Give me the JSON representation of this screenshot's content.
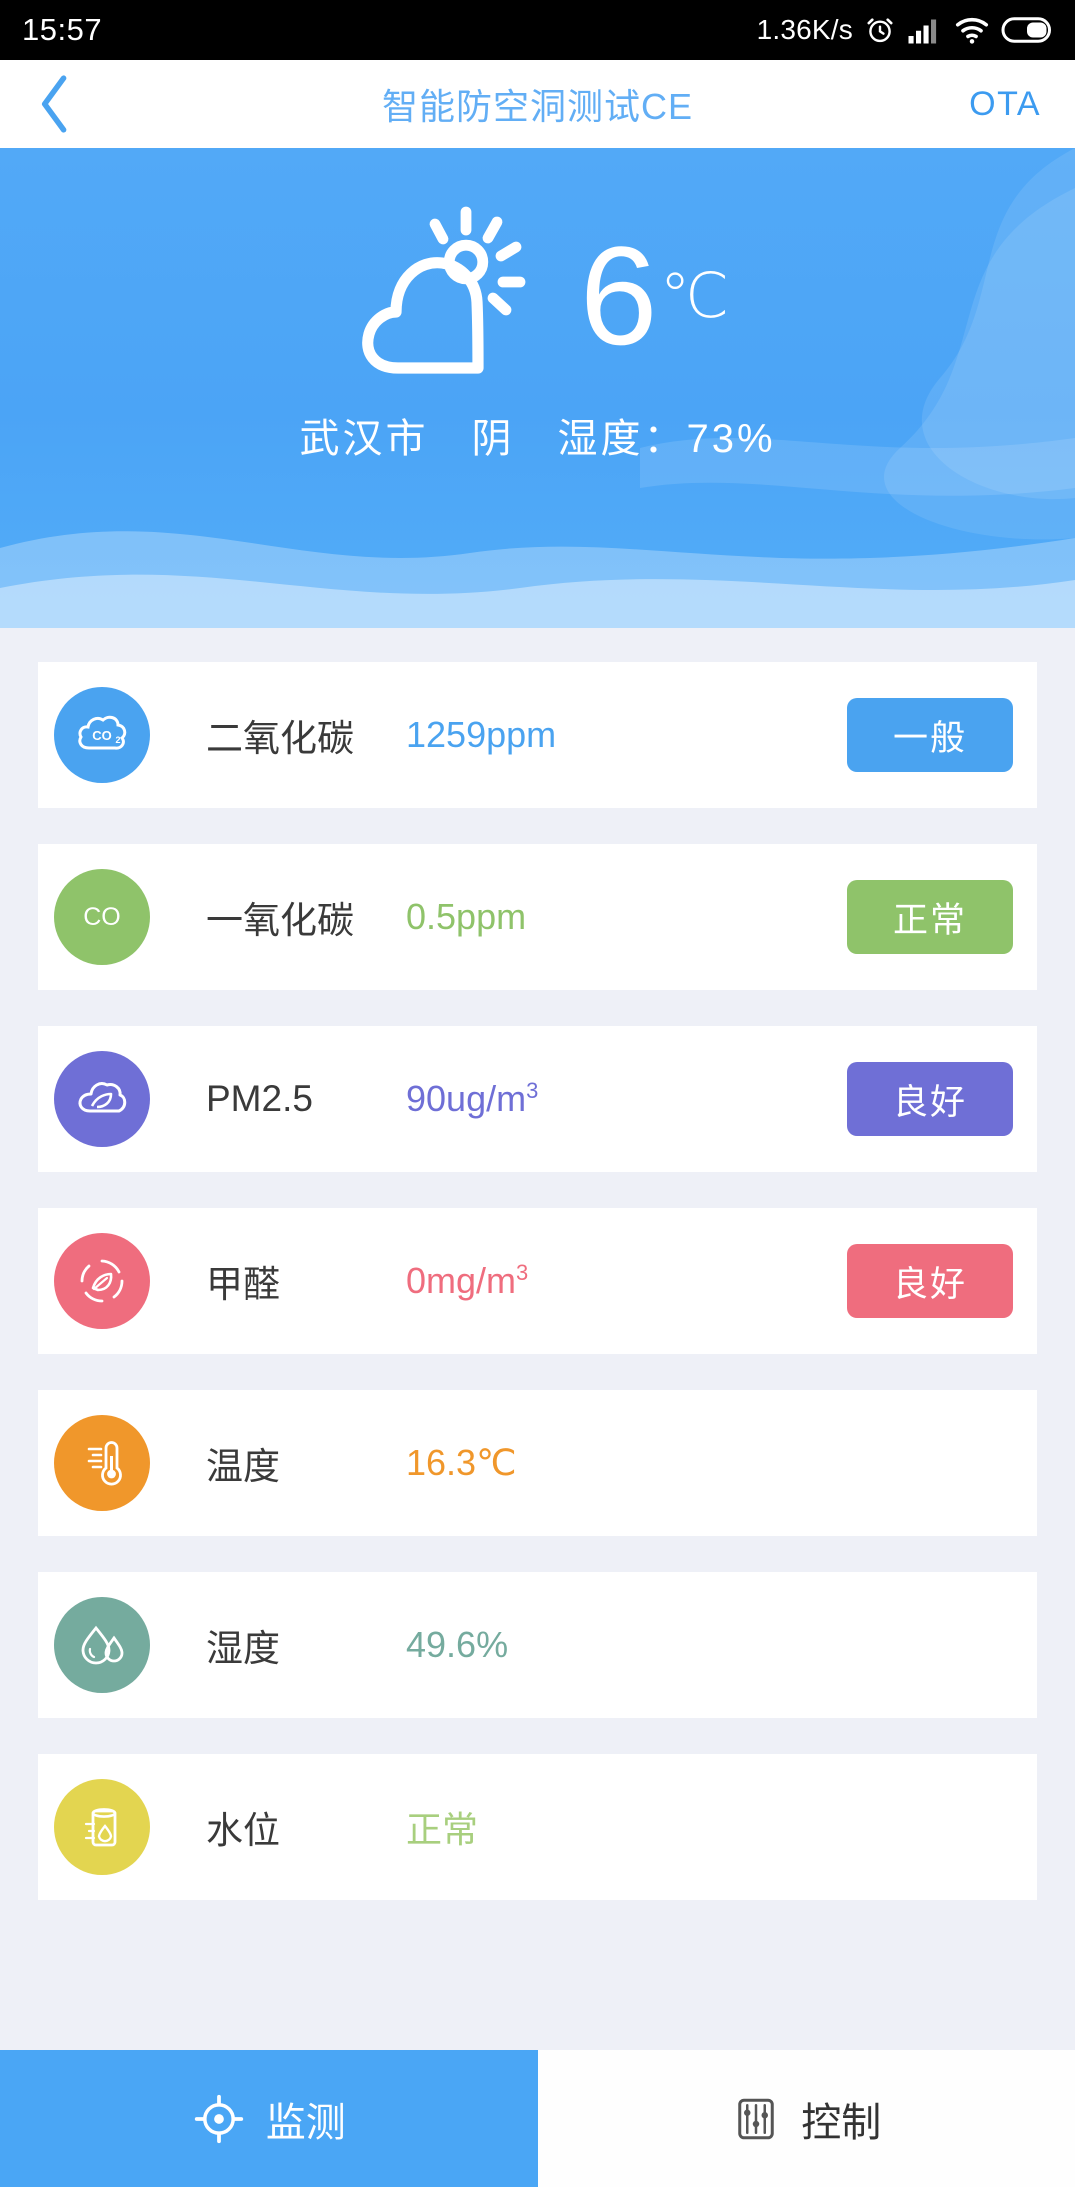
{
  "status_bar": {
    "time": "15:57",
    "network_speed": "1.36K/s",
    "icons": [
      "alarm-clock-icon",
      "cellular-signal-icon",
      "wifi-icon",
      "battery-icon"
    ]
  },
  "nav": {
    "back_icon": "chevron-left-icon",
    "title": "智能防空洞测试CE",
    "ota_label": "OTA",
    "title_color": "#62aef5"
  },
  "weather": {
    "icon": "sun-behind-cloud-icon",
    "temperature": "6",
    "unit": "℃",
    "summary": "武汉市　阴　湿度：73%",
    "city": "武汉市",
    "condition": "阴",
    "humidity_label": "湿度",
    "humidity_value": "73%",
    "background_color": "#4ba4f6"
  },
  "sensors": [
    {
      "icon": "co2-cloud-icon",
      "label": "二氧化碳",
      "value": "1259ppm",
      "status": "一般",
      "color": "#4aa3f0",
      "has_badge": true
    },
    {
      "icon": "co-text-icon",
      "label": "一氧化碳",
      "value": "0.5ppm",
      "status": "正常",
      "color": "#8fc36a",
      "has_badge": true
    },
    {
      "icon": "pm25-cloud-leaf-icon",
      "label": "PM2.5",
      "value": "90ug/m³",
      "value_base": "90ug/m",
      "value_sup": "3",
      "status": "良好",
      "color": "#6f6fd6",
      "has_badge": true
    },
    {
      "icon": "formaldehyde-leaf-circle-icon",
      "label": "甲醛",
      "value": "0mg/m³",
      "value_base": "0mg/m",
      "value_sup": "3",
      "status": "良好",
      "color": "#ef6d7e",
      "has_badge": true
    },
    {
      "icon": "thermometer-icon",
      "label": "温度",
      "value": "16.3℃",
      "status": "",
      "color": "#f0972b",
      "has_badge": false
    },
    {
      "icon": "water-drops-icon",
      "label": "湿度",
      "value": "49.6%",
      "status": "",
      "color": "#75ab9e",
      "has_badge": false
    },
    {
      "icon": "water-tank-level-icon",
      "label": "水位",
      "value": "正常",
      "status": "",
      "color": "#e3d550",
      "value_color": "#a8cf7e",
      "has_badge": false
    }
  ],
  "tabs": [
    {
      "icon": "crosshair-target-icon",
      "label": "监测",
      "active": true
    },
    {
      "icon": "sliders-control-icon",
      "label": "控制",
      "active": false
    }
  ]
}
